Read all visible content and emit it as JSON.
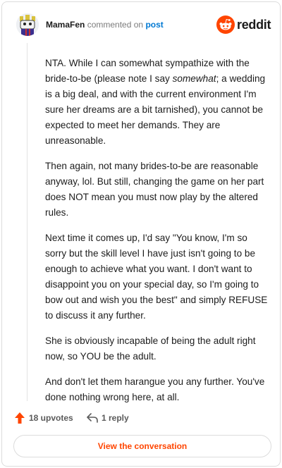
{
  "header": {
    "username": "MamaFen",
    "verb": "commented on",
    "post_link": "post",
    "brand_wordmark": "reddit"
  },
  "comment": {
    "paragraphs": [
      {
        "before": "NTA. While I can somewhat sympathize with the bride-to-be (please note I say ",
        "emphasis": "somewhat",
        "after": "; a wedding is a big deal, and with the current environment I'm sure her dreams are a bit tarnished), you cannot be expected to meet her demands. They are unreasonable."
      },
      "Then again, not many brides-to-be are reasonable anyway, lol. But still, changing the game on her part does NOT mean you must now play by the altered rules.",
      "Next time it comes up, I'd say \"You know, I'm so sorry but the skill level I have just isn't going to be enough to achieve what you want. I don't want to disappoint you on your special day, so I'm going to bow out and wish you the best\" and simply REFUSE to discuss it any further.",
      "She is obviously incapable of being the adult right now, so YOU be the adult.",
      "And don't let them harangue you any further. You've done nothing wrong here, at all."
    ]
  },
  "actions": {
    "upvotes": "18 upvotes",
    "replies": "1 reply"
  },
  "cta": {
    "label": "View the conversation"
  },
  "icons": {
    "upvote": "upvote-arrow-icon",
    "reply": "reply-arrow-icon",
    "brand": "reddit-snoo-logo",
    "avatar": "user-avatar-icon"
  },
  "colors": {
    "brand_orange": "#ff4500",
    "link_blue": "#0079d3",
    "muted_text": "#7c7c7c",
    "border": "#dcdcdc"
  }
}
